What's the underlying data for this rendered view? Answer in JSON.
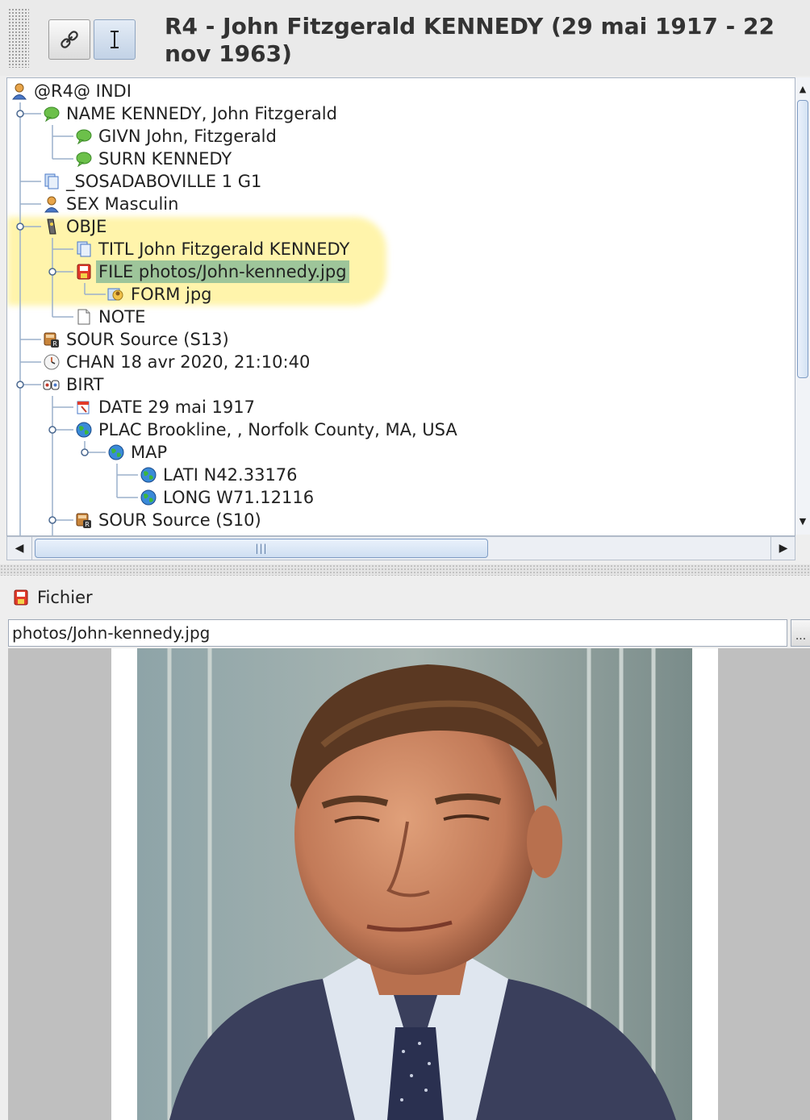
{
  "header": {
    "title": "R4 - John Fitzgerald KENNEDY (29 mai 1917 - 22 nov 1963)",
    "link_button_icon": "link-icon",
    "edit_button_icon": "text-cursor-icon"
  },
  "tree": {
    "rows": [
      {
        "label": "@R4@ INDI",
        "icon": "person-icon"
      },
      {
        "label": "NAME KENNEDY, John Fitzgerald",
        "icon": "speech-bubble-icon"
      },
      {
        "label": "GIVN John, Fitzgerald",
        "icon": "speech-bubble-icon"
      },
      {
        "label": "SURN KENNEDY",
        "icon": "speech-bubble-icon"
      },
      {
        "label": "_SOSADABOVILLE 1 G1",
        "icon": "pages-icon"
      },
      {
        "label": "SEX Masculin",
        "icon": "person-icon"
      },
      {
        "label": "OBJE",
        "icon": "media-object-icon"
      },
      {
        "label": "TITL John Fitzgerald KENNEDY",
        "icon": "pages-icon"
      },
      {
        "label": "FILE photos/John-kennedy.jpg",
        "icon": "file-icon",
        "selected": true
      },
      {
        "label": "FORM jpg",
        "icon": "image-format-icon"
      },
      {
        "label": "NOTE",
        "icon": "note-icon"
      },
      {
        "label": "SOUR Source (S13)",
        "icon": "source-icon"
      },
      {
        "label": "CHAN 18 avr 2020, 21:10:40",
        "icon": "clock-icon"
      },
      {
        "label": "BIRT",
        "icon": "birth-icon"
      },
      {
        "label": "DATE 29 mai 1917",
        "icon": "calendar-icon"
      },
      {
        "label": "PLAC Brookline, , Norfolk County, MA, USA",
        "icon": "globe-icon"
      },
      {
        "label": "MAP",
        "icon": "globe-icon"
      },
      {
        "label": "LATI N42.33176",
        "icon": "globe-icon"
      },
      {
        "label": "LONG W71.12116",
        "icon": "globe-icon"
      },
      {
        "label": "SOUR Source (S10)",
        "icon": "source-icon"
      }
    ]
  },
  "file_section": {
    "label": "Fichier",
    "path": "photos/John-kennedy.jpg",
    "browse_label": "..."
  },
  "colors": {
    "highlight": "#fff3a2",
    "selection": "#9ec59a",
    "scroll_accent": "#7e9cc4"
  }
}
